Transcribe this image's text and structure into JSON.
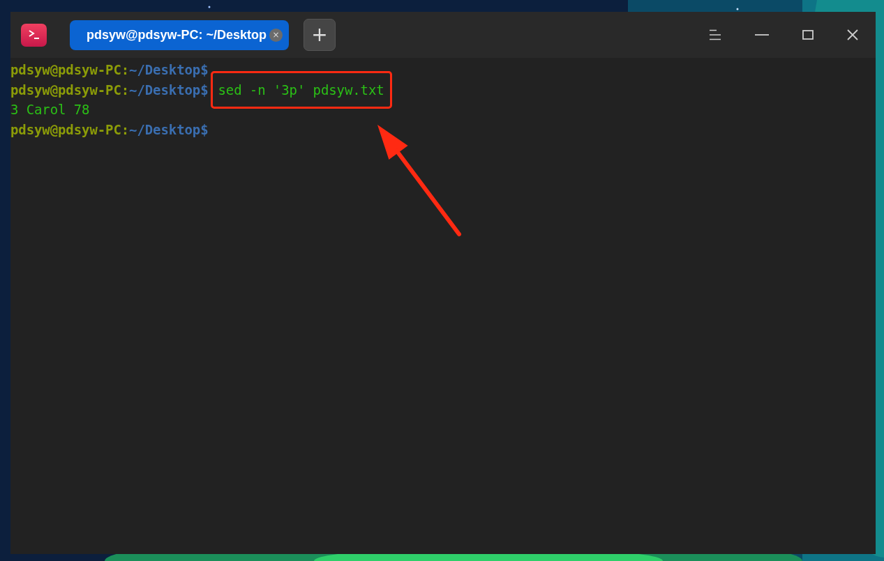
{
  "window": {
    "tabs": [
      {
        "title": "pdsyw@pdsyw-PC: ~/Desktop",
        "selected": true,
        "close": "×"
      }
    ],
    "new_tab": "+"
  },
  "terminal": {
    "lines": [
      {
        "kind": "prompt",
        "user_host": "pdsyw@pdsyw-PC",
        "sep": ":",
        "path": "~/Desktop",
        "symbol": "$"
      },
      {
        "kind": "prompt",
        "user_host": "pdsyw@pdsyw-PC",
        "sep": ":",
        "path": "~/Desktop",
        "symbol": "$",
        "command": "sed -n '3p' pdsyw.txt",
        "highlighted": true
      },
      {
        "kind": "output",
        "text": "3 Carol 78"
      },
      {
        "kind": "prompt",
        "user_host": "pdsyw@pdsyw-PC",
        "sep": ":",
        "path": "~/Desktop",
        "symbol": "$"
      }
    ]
  }
}
